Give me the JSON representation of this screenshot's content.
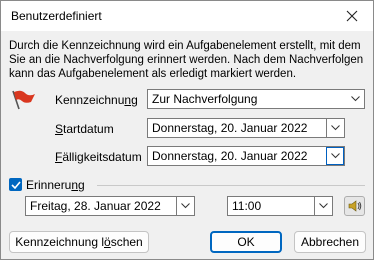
{
  "window": {
    "title": "Benutzerdefiniert"
  },
  "description": "Durch die Kennzeichnung wird ein Aufgabenelement erstellt, mit dem Sie an die Nachverfolgung erinnert werden. Nach dem Nachverfolgen kann das Aufgabenelement als erledigt markiert werden.",
  "flag": {
    "label_pre": "Kennzeichnu",
    "label_acc": "n",
    "label_post": "g",
    "value": "Zur Nachverfolgung"
  },
  "start": {
    "label_acc": "S",
    "label_post": "tartdatum",
    "value": "Donnerstag, 20. Januar 2022"
  },
  "due": {
    "label_acc": "F",
    "label_post": "älligkeitsdatum",
    "value": "Donnerstag, 20. Januar 2022"
  },
  "reminder": {
    "checked": true,
    "label_pre": "Erinneru",
    "label_acc": "n",
    "label_post": "g",
    "date": "Freitag, 28. Januar 2022",
    "time": "11:00"
  },
  "buttons": {
    "clear_pre": "Kennzeichnung l",
    "clear_acc": "ö",
    "clear_post": "schen",
    "ok": "OK",
    "cancel": "Abbrechen"
  },
  "colors": {
    "accent": "#0067c0",
    "flag": "#d9371f"
  }
}
